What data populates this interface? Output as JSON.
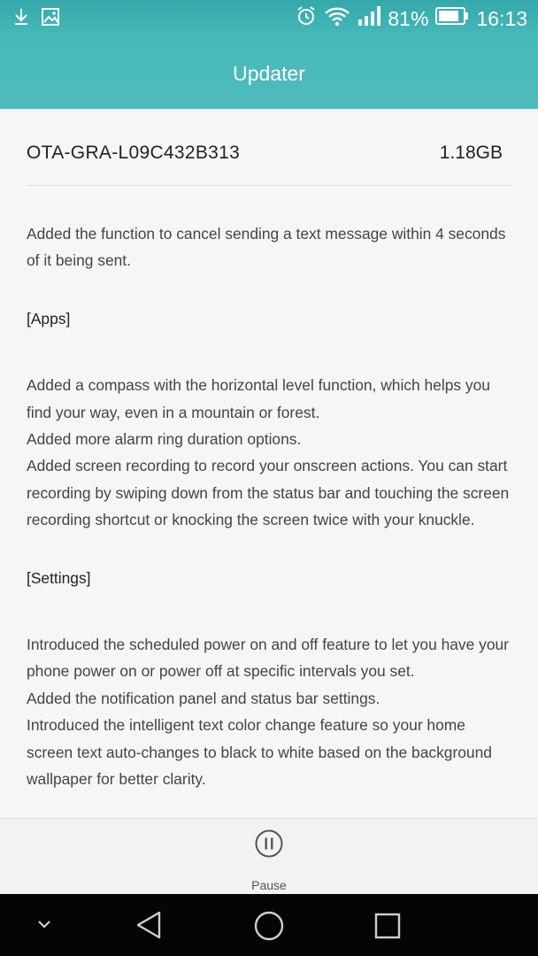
{
  "status_bar": {
    "battery_percent": "81%",
    "time": "16:13",
    "icons": [
      "download-icon",
      "image-icon",
      "alarm-icon",
      "wifi-icon",
      "signal-icon",
      "battery-icon"
    ]
  },
  "header": {
    "title": "Updater"
  },
  "package": {
    "name": "OTA-GRA-L09C432B313",
    "size": "1.18GB"
  },
  "notes": {
    "intro": "Added the function to cancel sending a text message within 4 seconds of it being sent.",
    "sections": [
      {
        "heading": "[Apps]",
        "items": [
          "Added a compass with the horizontal level function, which helps you find your way, even in a mountain or forest.",
          "Added more alarm ring duration options.",
          "Added screen recording to record your onscreen actions. You can start recording by swiping down from the status bar and touching the screen recording shortcut or knocking the screen twice with your knuckle."
        ]
      },
      {
        "heading": "[Settings]",
        "items": [
          "Introduced the scheduled power on and off feature to let you have your phone power on or power off at specific intervals you set.",
          "Added the notification panel and status bar settings.",
          "Introduced the intelligent text color change feature so your home screen text auto-changes to black to white based on the background wallpaper for better clarity."
        ]
      }
    ]
  },
  "actions": {
    "pause_label": "Pause",
    "pause_icon": "pause-circle-icon"
  },
  "nav_bar": {
    "icons": [
      "chevron-down-icon",
      "back-icon",
      "home-icon",
      "recents-icon"
    ]
  },
  "colors": {
    "header": "#4fbcbc",
    "background": "#f5f5f5",
    "nav_bar": "#050505"
  }
}
